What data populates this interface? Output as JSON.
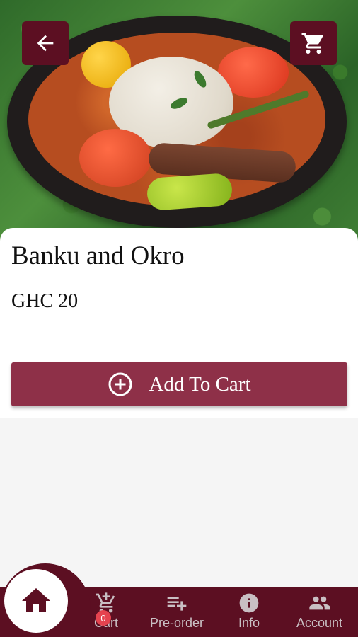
{
  "product": {
    "name": "Banku and Okro",
    "price": "GHC 20"
  },
  "actions": {
    "add_to_cart_label": "Add To Cart"
  },
  "header": {
    "back_icon": "arrow-left-icon",
    "cart_icon": "cart-icon"
  },
  "bottom_nav": {
    "items": [
      {
        "label": "",
        "icon": "home-icon"
      },
      {
        "label": "Cart",
        "icon": "cart-plus-icon",
        "badge": "0"
      },
      {
        "label": "Pre-order",
        "icon": "playlist-add-icon"
      },
      {
        "label": "Info",
        "icon": "info-icon"
      },
      {
        "label": "Account",
        "icon": "people-icon"
      }
    ]
  },
  "colors": {
    "primary_dark": "#5c0f22",
    "button": "#8e3048",
    "badge": "#e5434f"
  }
}
